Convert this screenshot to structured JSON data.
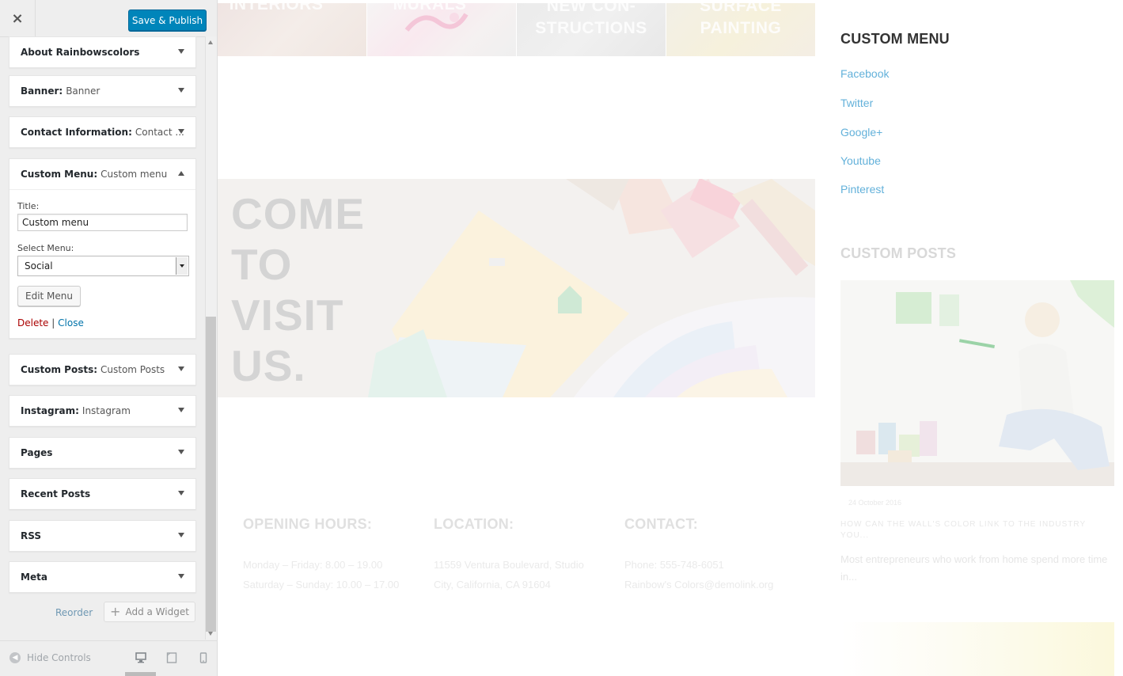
{
  "sidebar": {
    "close_label": "×",
    "save_label": "Save & Publish",
    "widgets": [
      {
        "title": "About Rainbowscolors",
        "subtitle": ""
      },
      {
        "title": "Banner:",
        "subtitle": "Banner"
      },
      {
        "title": "Contact Information:",
        "subtitle": "Contact ..."
      },
      {
        "title": "Custom Menu:",
        "subtitle": "Custom menu"
      },
      {
        "title": "Custom Posts:",
        "subtitle": "Custom Posts"
      },
      {
        "title": "Instagram:",
        "subtitle": "Instagram"
      },
      {
        "title": "Pages",
        "subtitle": ""
      },
      {
        "title": "Recent Posts",
        "subtitle": ""
      },
      {
        "title": "RSS",
        "subtitle": ""
      },
      {
        "title": "Meta",
        "subtitle": ""
      }
    ],
    "form": {
      "title_label": "Title:",
      "title_value": "Custom menu",
      "select_label": "Select Menu:",
      "select_value": "Social",
      "edit_button": "Edit Menu",
      "delete_link": "Delete",
      "separator": "|",
      "close_link": "Close"
    },
    "reorder_label": "Reorder",
    "add_widget_label": "Add a Widget",
    "hide_controls_label": "Hide Controls"
  },
  "preview": {
    "tiles": [
      "INTERIORS",
      "MURALS",
      "NEW CON-\nSTRUCTIONS",
      "SURFACE\nPAINTING"
    ],
    "banner_title": "COME\nTO\nVISIT\nUS.",
    "info": {
      "hours": {
        "heading": "OPENING HOURS:",
        "line1": "Monday – Friday: 8.00 – 19.00",
        "line2": "Saturday – Sunday: 10.00 – 17.00"
      },
      "location": {
        "heading": "LOCATION:",
        "line1": "11559 Ventura Boulevard, Studio",
        "line2": "City, California, CA 91604"
      },
      "contact": {
        "heading": "CONTACT:",
        "line1": "Phone: 555-748-6051",
        "line2": "Rainbow's Colors@demolink.org"
      }
    },
    "custom_menu": {
      "title": "CUSTOM MENU",
      "links": [
        "Facebook",
        "Twitter",
        "Google+",
        "Youtube",
        "Pinterest"
      ]
    },
    "custom_posts": {
      "title": "CUSTOM POSTS",
      "post_date": "24 October 2016",
      "post_title": "HOW CAN THE WALL'S COLOR LINK TO THE INDUSTRY YOU...",
      "post_excerpt": "Most entrepreneurs who work from home spend more time in..."
    }
  },
  "colors": {
    "accent": "#0085ba",
    "link": "#63b1da",
    "delete": "#a00"
  }
}
